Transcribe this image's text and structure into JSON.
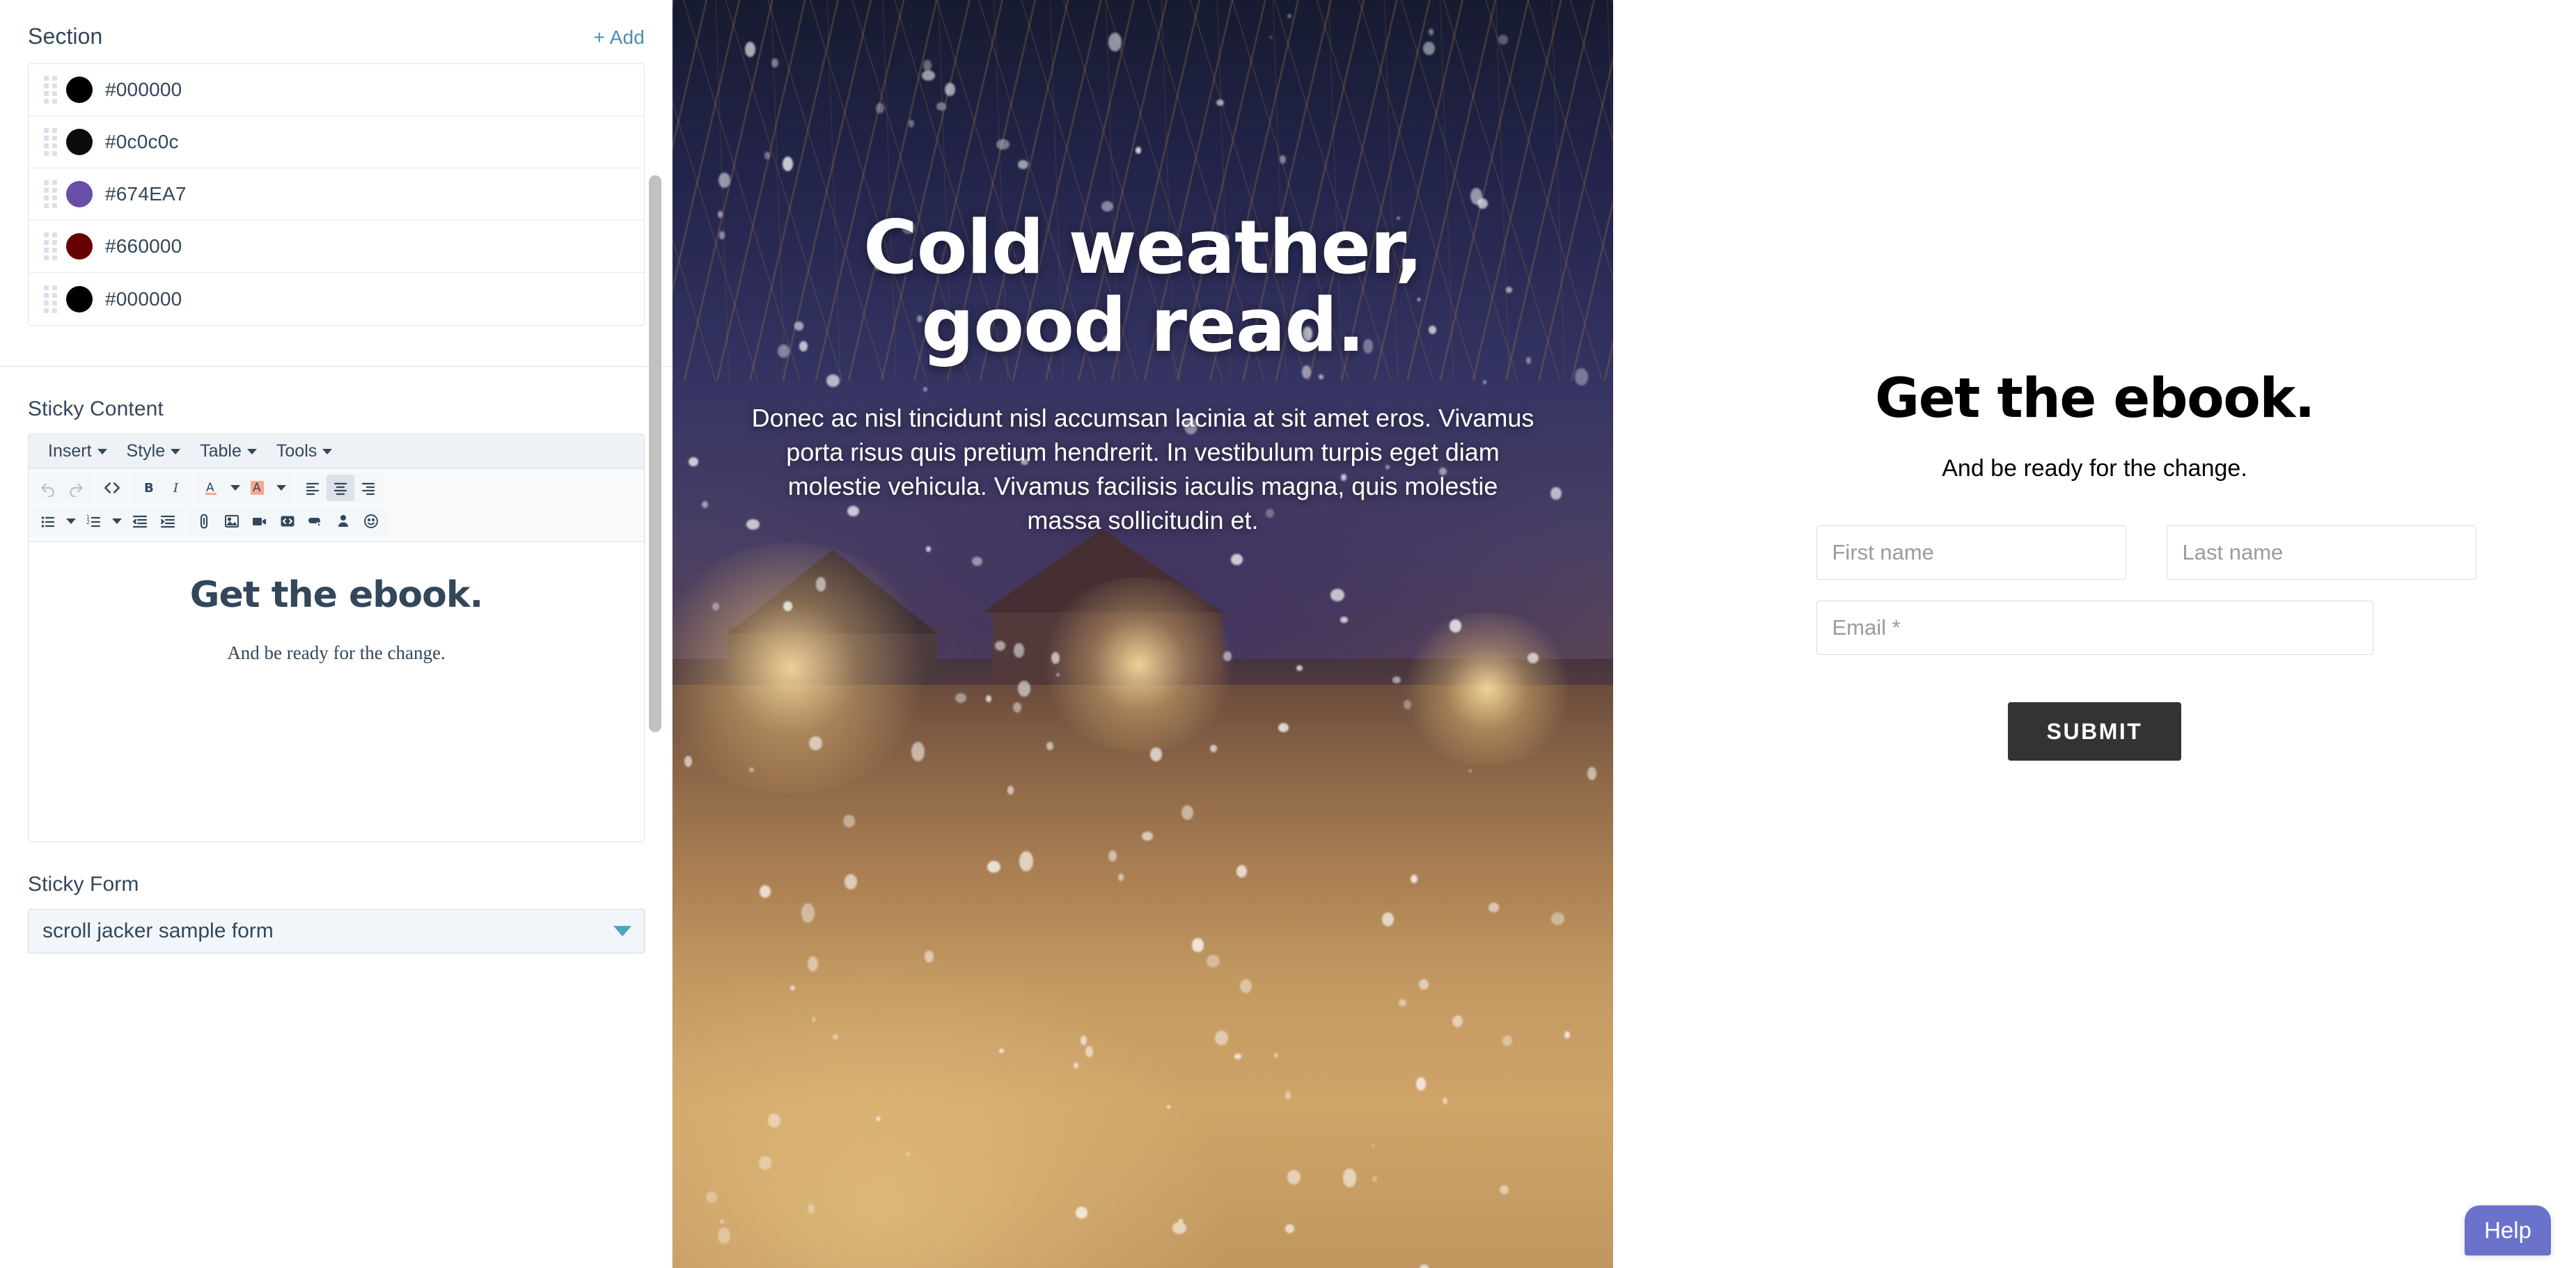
{
  "sidebar": {
    "section": {
      "title": "Section",
      "add_label": "+ Add",
      "colors": [
        {
          "hex": "#000000",
          "label": "#000000"
        },
        {
          "hex": "#0c0c0c",
          "label": "#0c0c0c"
        },
        {
          "hex": "#674EA7",
          "label": "#674EA7"
        },
        {
          "hex": "#660000",
          "label": "#660000"
        },
        {
          "hex": "#000000",
          "label": "#000000"
        }
      ]
    },
    "sticky_content": {
      "label": "Sticky Content",
      "menubar": [
        {
          "label": "Insert"
        },
        {
          "label": "Style"
        },
        {
          "label": "Table"
        },
        {
          "label": "Tools"
        }
      ],
      "toolbar_row1": [
        {
          "name": "undo-icon",
          "title": "Undo",
          "state": "disabled"
        },
        {
          "name": "redo-icon",
          "title": "Redo",
          "state": "disabled"
        },
        {
          "name": "source-code-icon",
          "title": "Source code",
          "state": "normal"
        },
        {
          "name": "bold-icon",
          "title": "Bold",
          "state": "normal"
        },
        {
          "name": "italic-icon",
          "title": "Italic",
          "state": "normal"
        },
        {
          "name": "text-color-icon",
          "title": "Text color",
          "state": "normal"
        },
        {
          "name": "text-color-dropdown-icon",
          "title": "Text color options",
          "state": "normal"
        },
        {
          "name": "highlight-color-icon",
          "title": "Background color",
          "state": "normal"
        },
        {
          "name": "highlight-color-dropdown-icon",
          "title": "Background color options",
          "state": "normal"
        },
        {
          "name": "align-left-icon",
          "title": "Align left",
          "state": "normal"
        },
        {
          "name": "align-center-icon",
          "title": "Align center",
          "state": "active"
        },
        {
          "name": "align-right-icon",
          "title": "Align right",
          "state": "normal"
        }
      ],
      "toolbar_row2": [
        {
          "name": "bullet-list-icon",
          "title": "Bullet list"
        },
        {
          "name": "bullet-list-dropdown-icon",
          "title": "Bullet list options"
        },
        {
          "name": "numbered-list-icon",
          "title": "Numbered list"
        },
        {
          "name": "numbered-list-dropdown-icon",
          "title": "Numbered list options"
        },
        {
          "name": "outdent-icon",
          "title": "Decrease indent"
        },
        {
          "name": "indent-icon",
          "title": "Increase indent"
        },
        {
          "name": "link-icon",
          "title": "Insert link"
        },
        {
          "name": "image-icon",
          "title": "Insert image"
        },
        {
          "name": "video-icon",
          "title": "Insert video"
        },
        {
          "name": "embed-code-icon",
          "title": "Insert embed code"
        },
        {
          "name": "cta-button-icon",
          "title": "Insert CTA"
        },
        {
          "name": "personalize-icon",
          "title": "Personalize"
        },
        {
          "name": "emoji-icon",
          "title": "Insert emoji"
        }
      ],
      "body": {
        "heading": "Get the ebook.",
        "subheading": "And be ready for the change."
      }
    },
    "sticky_form": {
      "label": "Sticky Form",
      "selected": "scroll jacker sample form"
    }
  },
  "preview": {
    "heading_line1": "Cold weather,",
    "heading_line2": "good read.",
    "body": "Donec ac nisl tincidunt nisl accumsan lacinia at sit amet eros. Vivamus porta risus quis pretium hendrerit. In vestibulum turpis eget diam molestie vehicula. Vivamus facilisis iaculis magna, quis molestie massa sollicitudin et."
  },
  "form_panel": {
    "heading": "Get the ebook.",
    "subheading": "And be ready for the change.",
    "fields": [
      {
        "name": "first-name",
        "placeholder": "First name",
        "value": ""
      },
      {
        "name": "last-name",
        "placeholder": "Last name",
        "value": ""
      },
      {
        "name": "email",
        "placeholder": "Email *",
        "value": ""
      }
    ],
    "submit_label": "SUBMIT"
  },
  "help": {
    "label": "Help"
  },
  "colors": {
    "accent_link": "#4a90a8",
    "text_primary": "#33475b",
    "submit_bg": "#333333",
    "help_bg": "#6b72cc",
    "toolbar_bg": "#eef1f6",
    "border": "#dfe3eb"
  }
}
